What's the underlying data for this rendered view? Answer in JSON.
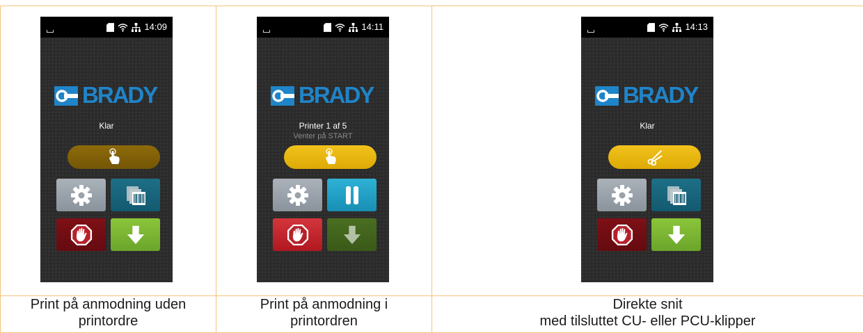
{
  "colors": {
    "grid_border": "#f5c27a",
    "screen_bg": "#2b2b2b",
    "brand_blue": "#1f84c8",
    "amber_dim": "#8e6a0a",
    "amber_bright": "#f2c21c",
    "gear_tile": "#9aa2aa",
    "teal_dark": "#1d6f86",
    "teal_bright": "#2fb1d6",
    "red_dark": "#7d1016",
    "red_bright": "#d4353c",
    "green_bright": "#8bc53a",
    "green_dark": "#4a6e22"
  },
  "panels": [
    {
      "screen": {
        "time": "14:09",
        "logo_text": "BRADY",
        "status_line1": "Klar",
        "status_line2": "",
        "main_button_icon": "hand-tap-icon",
        "main_button_state": "dimmed",
        "tiles": [
          "gear-icon",
          "label-feed-icon",
          "stop-hand-icon",
          "arrow-down-icon"
        ]
      },
      "caption": [
        "Print på anmodning uden",
        "printordre"
      ]
    },
    {
      "screen": {
        "time": "14:11",
        "logo_text": "BRADY",
        "status_line1": "Printer 1 af 5",
        "status_line2": "Venter på START",
        "main_button_icon": "hand-tap-icon",
        "main_button_state": "active",
        "tiles": [
          "gear-icon",
          "pause-icon",
          "stop-hand-icon",
          "arrow-down-icon"
        ]
      },
      "caption": [
        "Print på anmodning i",
        "printordren"
      ]
    },
    {
      "screen": {
        "time": "14:13",
        "logo_text": "BRADY",
        "status_line1": "Klar",
        "status_line2": "",
        "main_button_icon": "scissors-icon",
        "main_button_state": "active",
        "tiles": [
          "gear-icon",
          "label-feed-icon",
          "stop-hand-icon",
          "arrow-down-icon"
        ]
      },
      "caption": [
        "Direkte snit",
        "med tilsluttet CU- eller PCU-klipper"
      ]
    }
  ]
}
